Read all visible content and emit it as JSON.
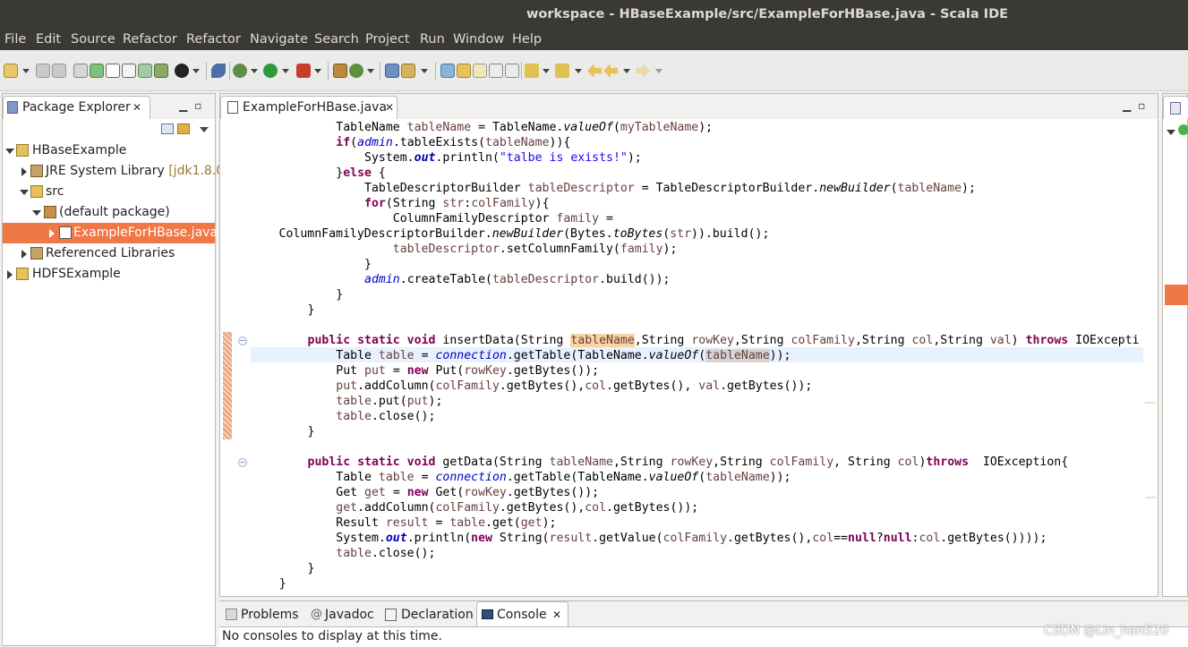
{
  "window": {
    "title": "workspace - HBaseExample/src/ExampleForHBase.java - Scala IDE"
  },
  "menu": [
    "File",
    "Edit",
    "Source",
    "Refactor",
    "Refactor",
    "Navigate",
    "Search",
    "Project",
    "Run",
    "Window",
    "Help"
  ],
  "package_explorer": {
    "tab_label": "Package Explorer",
    "tree": [
      {
        "label": "HBaseExample",
        "state": "expanded",
        "icon": "project-icon"
      },
      {
        "label": "JRE System Library",
        "suffix": "[jdk1.8.0",
        "state": "collapsed",
        "icon": "library-icon"
      },
      {
        "label": "src",
        "state": "expanded",
        "icon": "source-folder-icon"
      },
      {
        "label": "(default package)",
        "state": "expanded",
        "icon": "package-icon"
      },
      {
        "label": "ExampleForHBase.java",
        "state": "collapsed",
        "icon": "java-file-icon",
        "selected": true
      },
      {
        "label": "Referenced Libraries",
        "state": "collapsed",
        "icon": "library-icon"
      },
      {
        "label": "HDFSExample",
        "state": "collapsed",
        "icon": "project-icon"
      }
    ]
  },
  "editor": {
    "tab_label": "ExampleForHBase.java"
  },
  "bottom_panel": {
    "tabs": [
      "Problems",
      "Javadoc",
      "Declaration",
      "Console"
    ],
    "active_tab": "Console",
    "message": "No consoles to display at this time."
  },
  "watermark": "CSDN @Lin_han520",
  "colors": {
    "selection": "#f07746",
    "title_bar": "#3a3935",
    "keyword": "#7f0055",
    "field": "#0000c0",
    "string": "#2a00ff"
  }
}
